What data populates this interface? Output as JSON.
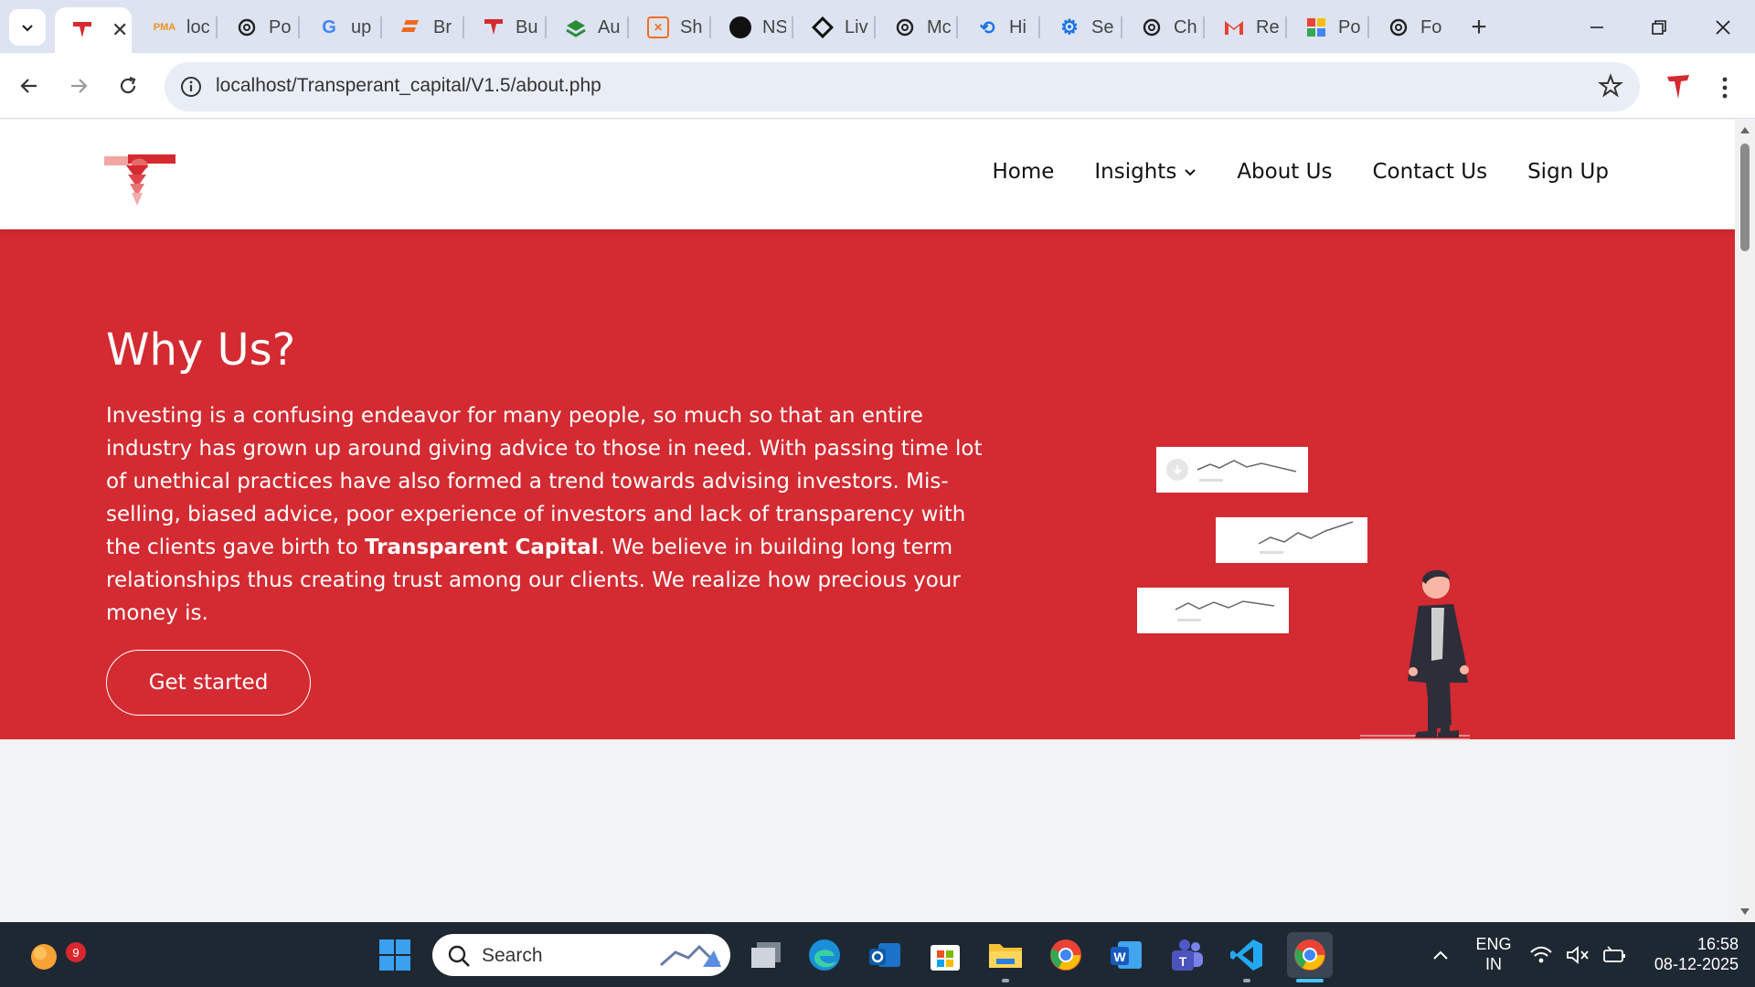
{
  "browser": {
    "tabs": [
      {
        "title": "",
        "icon": "tc-logo",
        "active": true
      },
      {
        "title": "loc",
        "icon": "pma-icon"
      },
      {
        "title": "Po",
        "icon": "openai-icon"
      },
      {
        "title": "up",
        "icon": "google-icon"
      },
      {
        "title": "Br",
        "icon": "brand-icon"
      },
      {
        "title": "Bu",
        "icon": "tc-logo"
      },
      {
        "title": "Au",
        "icon": "stack-icon"
      },
      {
        "title": "Sh",
        "icon": "xampp-icon"
      },
      {
        "title": "NS",
        "icon": "ns-icon"
      },
      {
        "title": "Liv",
        "icon": "diamond-icon"
      },
      {
        "title": "Mc",
        "icon": "openai-icon"
      },
      {
        "title": "Hi",
        "icon": "history-icon"
      },
      {
        "title": "Se",
        "icon": "settings-icon"
      },
      {
        "title": "Ch",
        "icon": "openai-icon"
      },
      {
        "title": "Re",
        "icon": "gmail-icon"
      },
      {
        "title": "Po",
        "icon": "photos-icon"
      },
      {
        "title": "Fo",
        "icon": "openai-icon"
      }
    ],
    "url": "localhost/Transperant_capital/V1.5/about.php"
  },
  "site": {
    "nav": {
      "home": "Home",
      "insights": "Insights",
      "about": "About Us",
      "contact": "Contact Us",
      "signup": "Sign Up"
    },
    "hero": {
      "title": "Why Us?",
      "para_before": "Investing is a confusing endeavor for many people, so much so that an entire industry has grown up around giving advice to those in need. With passing time lot of unethical practices have also formed a trend towards advising investors. Mis-selling, biased advice, poor experience of investors and lack of transparency with the clients gave birth to ",
      "para_bold": "Transparent Capital",
      "para_after": ". We believe in building long term relationships thus creating trust among our clients. We realize how precious your money is.",
      "cta": "Get started"
    },
    "colors": {
      "brand_red": "#d42a31"
    }
  },
  "taskbar": {
    "search_placeholder": "Search",
    "notification_count": "9",
    "lang_line1": "ENG",
    "lang_line2": "IN",
    "time": "16:58",
    "date": "08-12-2025"
  }
}
